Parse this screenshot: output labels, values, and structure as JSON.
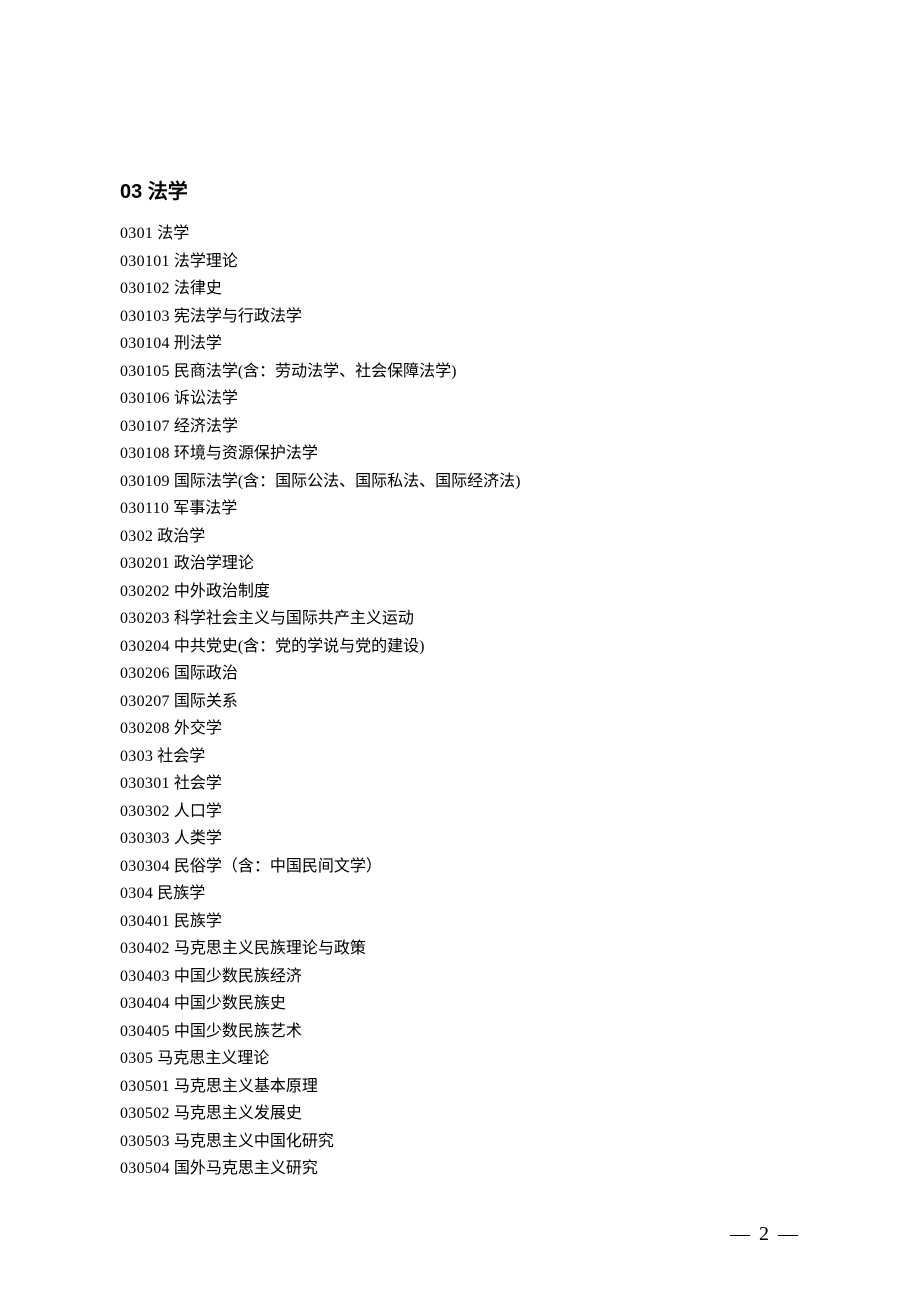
{
  "heading": {
    "code": "03",
    "title": "法学"
  },
  "entries": [
    {
      "code": "0301",
      "text": "法学"
    },
    {
      "code": "030101",
      "text": "法学理论"
    },
    {
      "code": "030102",
      "text": "法律史"
    },
    {
      "code": "030103",
      "text": "宪法学与行政法学"
    },
    {
      "code": "030104",
      "text": "刑法学"
    },
    {
      "code": "030105",
      "text": "民商法学(含：劳动法学、社会保障法学)"
    },
    {
      "code": "030106",
      "text": "诉讼法学"
    },
    {
      "code": "030107",
      "text": "经济法学"
    },
    {
      "code": "030108",
      "text": "环境与资源保护法学"
    },
    {
      "code": "030109",
      "text": "国际法学(含：国际公法、国际私法、国际经济法)"
    },
    {
      "code": "030110",
      "text": "军事法学"
    },
    {
      "code": "0302",
      "text": "政治学"
    },
    {
      "code": "030201",
      "text": "政治学理论"
    },
    {
      "code": "030202",
      "text": "中外政治制度"
    },
    {
      "code": "030203",
      "text": "科学社会主义与国际共产主义运动"
    },
    {
      "code": "030204",
      "text": "中共党史(含：党的学说与党的建设)"
    },
    {
      "code": "030206",
      "text": "国际政治"
    },
    {
      "code": "030207",
      "text": "国际关系"
    },
    {
      "code": "030208",
      "text": "外交学"
    },
    {
      "code": "0303",
      "text": "社会学"
    },
    {
      "code": "030301",
      "text": "社会学"
    },
    {
      "code": "030302",
      "text": "人口学"
    },
    {
      "code": "030303",
      "text": "人类学"
    },
    {
      "code": "030304",
      "text": "民俗学（含：中国民间文学）"
    },
    {
      "code": "0304",
      "text": "民族学"
    },
    {
      "code": "030401",
      "text": "民族学"
    },
    {
      "code": "030402",
      "text": "马克思主义民族理论与政策"
    },
    {
      "code": "030403",
      "text": "中国少数民族经济"
    },
    {
      "code": "030404",
      "text": "中国少数民族史"
    },
    {
      "code": "030405",
      "text": "中国少数民族艺术"
    },
    {
      "code": "0305",
      "text": "马克思主义理论"
    },
    {
      "code": "030501",
      "text": "马克思主义基本原理"
    },
    {
      "code": "030502",
      "text": "马克思主义发展史"
    },
    {
      "code": "030503",
      "text": "马克思主义中国化研究"
    },
    {
      "code": "030504",
      "text": "国外马克思主义研究"
    }
  ],
  "pageNumber": "— 2 —"
}
